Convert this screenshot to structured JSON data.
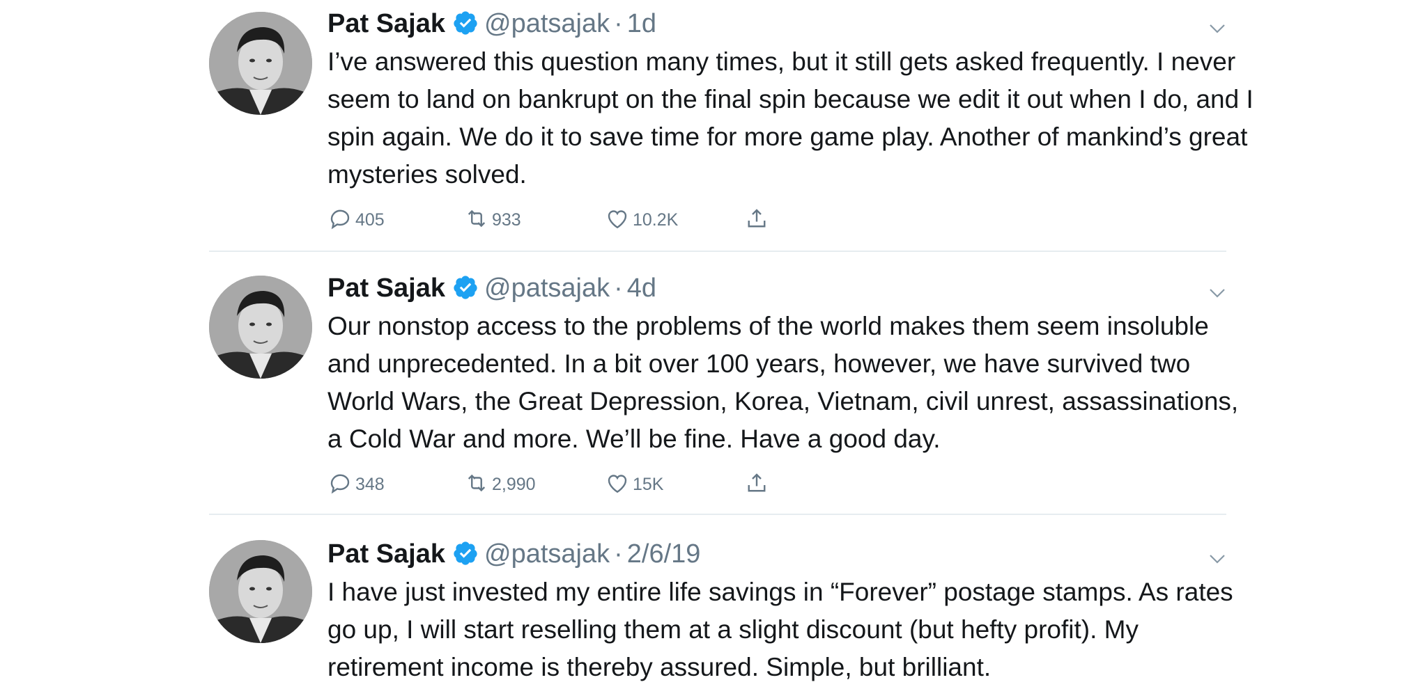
{
  "icons": {
    "verified": "verified-badge-icon",
    "caret": "chevron-down-icon",
    "reply": "reply-icon",
    "retweet": "retweet-icon",
    "like": "heart-icon",
    "share": "share-icon"
  },
  "colors": {
    "verified": "#1da1f2",
    "secondary_text": "#657786",
    "primary_text": "#14171a",
    "divider": "#e6ecf0"
  },
  "tweets": [
    {
      "name": "Pat Sajak",
      "handle": "@patsajak",
      "separator": "·",
      "time": "1d",
      "text": "I’ve answered this question many times, but it still gets asked frequently. I never seem to land on bankrupt on the final spin because we edit it out when I do, and I spin again. We do it to save time for more game play. Another of mankind’s great mysteries solved.",
      "replies": "405",
      "retweets": "933",
      "likes": "10.2K"
    },
    {
      "name": "Pat Sajak",
      "handle": "@patsajak",
      "separator": "·",
      "time": "4d",
      "text": "Our nonstop access to the problems of the world makes them seem insoluble and unprecedented. In a bit over 100 years, however, we have survived two World Wars, the Great Depression, Korea, Vietnam, civil unrest, assassinations, a Cold War and more. We’ll be fine. Have a good day.",
      "replies": "348",
      "retweets": "2,990",
      "likes": "15K"
    },
    {
      "name": "Pat Sajak",
      "handle": "@patsajak",
      "separator": "·",
      "time": "2/6/19",
      "text": "I have just invested my entire life savings in “Forever” postage stamps. As rates go up, I will start reselling them at a slight discount (but hefty profit). My retirement income is thereby assured. Simple, but brilliant."
    }
  ]
}
